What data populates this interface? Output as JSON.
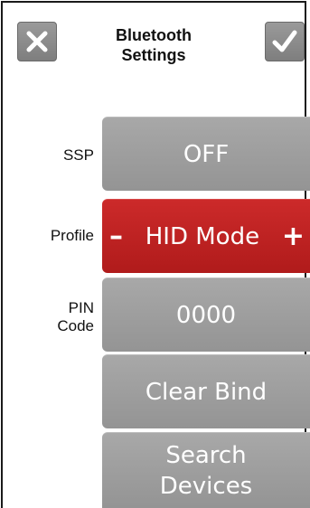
{
  "header": {
    "title_line1": "Bluetooth",
    "title_line2": "Settings"
  },
  "icons": {
    "cancel": "close-icon",
    "confirm": "checkmark-icon"
  },
  "rows": {
    "ssp": {
      "label": "SSP",
      "value": "OFF"
    },
    "profile": {
      "label": "Profile",
      "minus": "–",
      "value": "HID Mode",
      "plus": "+"
    },
    "pin": {
      "label_line1": "PIN",
      "label_line2": "Code",
      "value": "0000"
    },
    "clear_bind": {
      "label": "Clear Bind"
    },
    "search": {
      "label_line1": "Search",
      "label_line2": "Devices"
    }
  },
  "colors": {
    "button_gray": "#9e9e9e",
    "profile_red": "#c02323",
    "text_white": "#ffffff"
  }
}
